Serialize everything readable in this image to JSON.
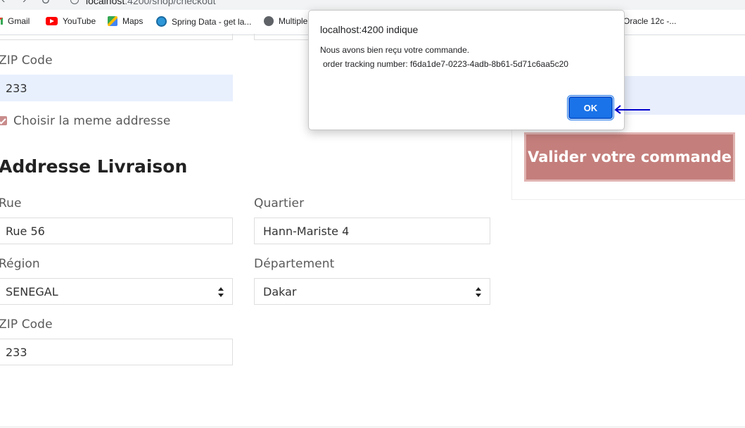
{
  "browser": {
    "url_host": "localhost",
    "url_path": ":4200/shop/checkout",
    "bookmarks": [
      "Gmail",
      "YouTube",
      "Maps",
      "Spring Data - get la...",
      "Multiple",
      "Oracle 12c -..."
    ]
  },
  "billing": {
    "zip_label": "ZIP Code",
    "zip_value": "233",
    "same_address_label": "Choisir la meme addresse",
    "same_address_checked": true
  },
  "shipping": {
    "title": "Addresse Livraison",
    "street_label": "Rue",
    "street_value": "Rue 56",
    "district_label": "Quartier",
    "district_value": "Hann-Mariste 4",
    "region_label": "Région",
    "region_value": "SENEGAL",
    "department_label": "Département",
    "department_value": "Dakar",
    "zip_label": "ZIP Code",
    "zip_value": "233"
  },
  "summary": {
    "submit_label": "Valider votre commande"
  },
  "dialog": {
    "title": "localhost:4200 indique",
    "message_line1": "Nous avons bien reçu votre commande.",
    "message_line2": "order tracking number: f6da1de7-0223-4adb-8b61-5d71c6aa5c20",
    "ok_label": "OK"
  },
  "colors": {
    "accent": "#c47f7c",
    "autofill": "#e8f0fe",
    "dialog_button": "#1a73e8",
    "annotation_arrow": "#0000cc"
  }
}
